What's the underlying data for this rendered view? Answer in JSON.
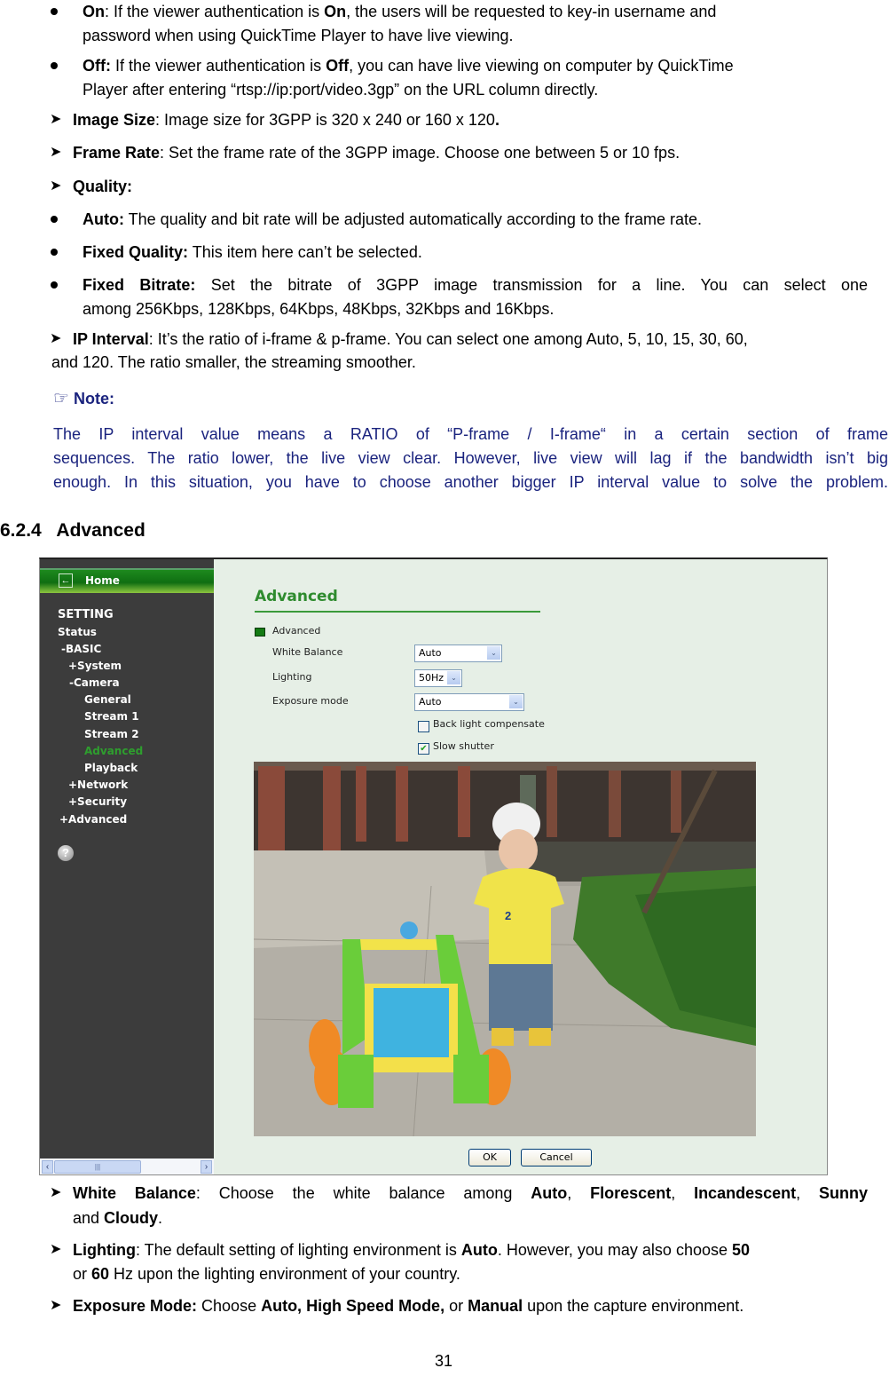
{
  "body_top": {
    "on_item": {
      "term": "On",
      "text1": ": If the viewer authentication is ",
      "term2": "On",
      "text2": ", the users will be requested to key-in username and",
      "line2": "password when using QuickTime Player to have live viewing."
    },
    "off_item": {
      "term": "Off:",
      "text1": " If the viewer authentication is ",
      "term2": "Off",
      "text2": ", you can have live viewing on computer by QuickTime",
      "line2": "Player after entering “rtsp://ip:port/video.3gp” on the URL column directly."
    },
    "image_size": {
      "term": "Image Size",
      "text": ": Image size for 3GPP is 320 x 240 or 160 x 120",
      "end": "."
    },
    "frame_rate": {
      "term": "Frame Rate",
      "text": ": Set the frame rate of the 3GPP image. Choose one between 5 or 10 fps."
    },
    "quality": {
      "term": "Quality:"
    },
    "auto_item": {
      "term": "Auto:",
      "text": " The quality and bit rate will be adjusted automatically according to the frame rate."
    },
    "fixed_quality": {
      "term": "Fixed Quality:",
      "text": " This item here can’t be selected."
    },
    "fixed_bitrate": {
      "term": "Fixed Bitrate:",
      "text": " Set the bitrate of 3GPP image transmission for a line. You can select one",
      "line2": "among 256Kbps, 128Kbps, 64Kbps, 48Kbps, 32Kbps and 16Kbps."
    },
    "ip_interval": {
      "term": "IP Interval",
      "text": ": It’s the ratio of i-frame & p-frame. You can select one among Auto, 5, 10, 15, 30, 60,",
      "line2": "and 120. The ratio smaller, the streaming smoother."
    }
  },
  "note": {
    "label": "Note:",
    "line1": "The IP interval value means a RATIO of “P-frame / I-frame“ in a certain section of frame",
    "line2": "sequences. The ratio lower, the live view clear. However, live view will lag if the bandwidth isn’t big",
    "line3": "enough. In this situation, you have to choose another bigger IP interval value to solve the problem."
  },
  "section_heading": "6.2.4   Advanced",
  "screenshot": {
    "home_label": "Home",
    "nav": [
      {
        "label": "SETTING"
      },
      {
        "label": "Status"
      },
      {
        "label": "-BASIC"
      },
      {
        "label": "+System"
      },
      {
        "label": "-Camera"
      },
      {
        "label": "General"
      },
      {
        "label": "Stream 1"
      },
      {
        "label": "Stream 2"
      },
      {
        "label": "Advanced",
        "active": true
      },
      {
        "label": "Playback"
      },
      {
        "label": "+Network"
      },
      {
        "label": "+Security"
      },
      {
        "label": "+Advanced"
      }
    ],
    "help_glyph": "?",
    "page_title": "Advanced",
    "section_label": "Advanced",
    "fields": {
      "white_balance": {
        "label": "White Balance",
        "value": "Auto"
      },
      "lighting": {
        "label": "Lighting",
        "value": "50Hz"
      },
      "exposure_mode": {
        "label": "Exposure mode",
        "value": "Auto"
      }
    },
    "checkboxes": {
      "back_light": {
        "label": "Back light compensate",
        "checked": false
      },
      "slow_shutter": {
        "label": "Slow shutter",
        "checked": true
      }
    },
    "ok_label": "OK",
    "cancel_label": "Cancel",
    "accent_color": "#2e8b2e"
  },
  "body_bottom": {
    "white_balance": {
      "term": "White Balance",
      "t1": ": Choose the white balance among ",
      "o1": "Auto",
      "s1": ", ",
      "o2": "Florescent",
      "s2": ", ",
      "o3": "Incandescent",
      "s3": ", ",
      "o4": "Sunny",
      "line2a": "and ",
      "o5": "Cloudy",
      "line2b": "."
    },
    "lighting": {
      "term": "Lighting",
      "t1": ": The default setting of lighting environment is ",
      "o1": "Auto",
      "t2": ". However, you may also choose ",
      "o2": "50",
      "line2a": "or ",
      "o3": "60",
      "line2b": " Hz upon the lighting environment of your country."
    },
    "exposure": {
      "term": "Exposure Mode:",
      "t1": " Choose ",
      "o1": "Auto, High Speed Mode,",
      "t2": " or ",
      "o2": "Manual",
      "t3": " upon the capture environment."
    }
  },
  "page_number": "31"
}
